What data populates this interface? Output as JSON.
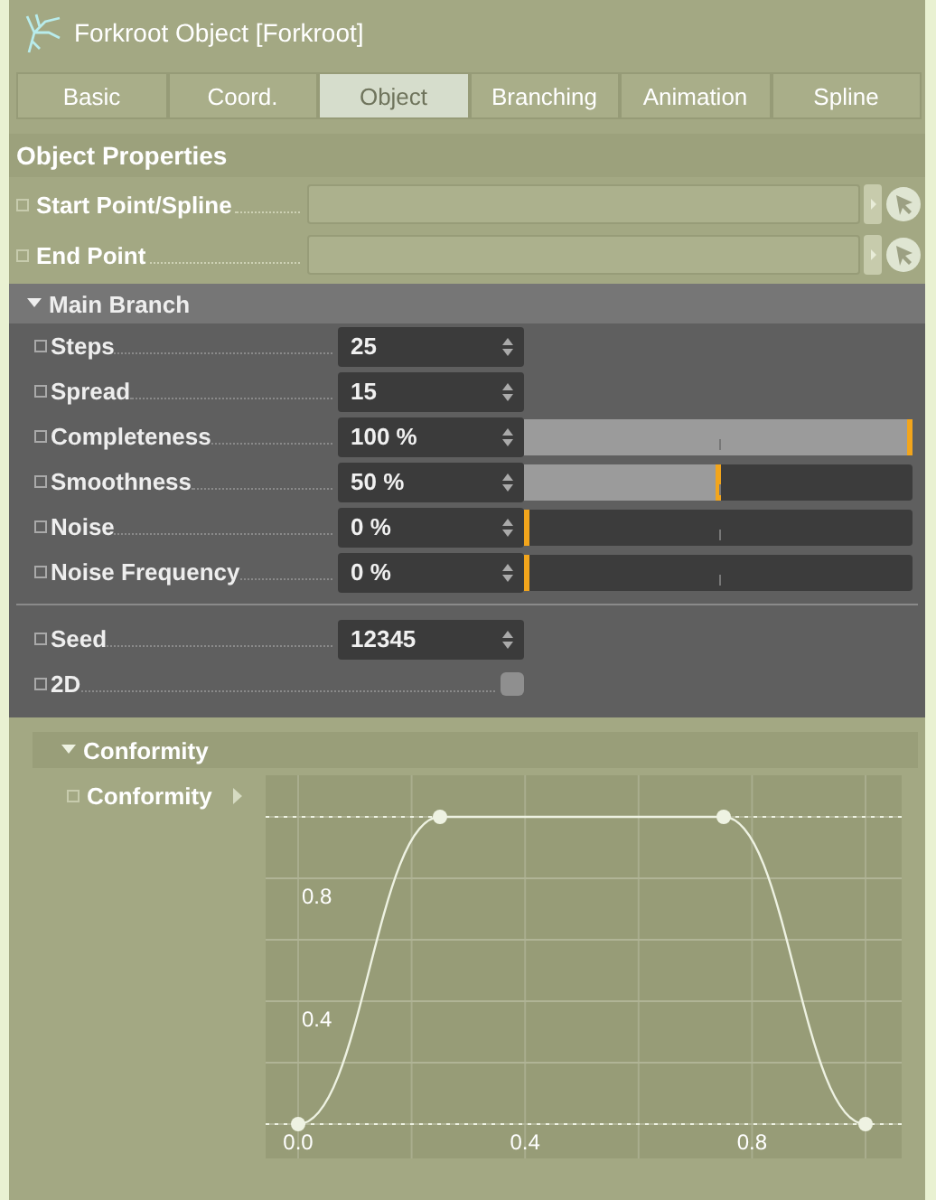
{
  "window": {
    "title": "Forkroot Object [Forkroot]"
  },
  "tabs": [
    {
      "label": "Basic",
      "selected": false
    },
    {
      "label": "Coord.",
      "selected": false
    },
    {
      "label": "Object",
      "selected": true
    },
    {
      "label": "Branching",
      "selected": false
    },
    {
      "label": "Animation",
      "selected": false
    },
    {
      "label": "Spline",
      "selected": false
    }
  ],
  "object_properties": {
    "title": "Object Properties",
    "links": [
      {
        "label": "Start Point/Spline"
      },
      {
        "label": "End Point"
      }
    ]
  },
  "main_branch": {
    "title": "Main Branch",
    "expanded": true,
    "parameters": [
      {
        "kind": "number",
        "label": "Steps",
        "value": "25"
      },
      {
        "kind": "number",
        "label": "Spread",
        "value": "15"
      },
      {
        "kind": "slider",
        "label": "Completeness",
        "value": "100 %",
        "level": 1
      },
      {
        "kind": "slider",
        "label": "Smoothness",
        "value": "50 %",
        "level": 0.5
      },
      {
        "kind": "slider",
        "label": "Noise",
        "value": "0 %",
        "level": 0
      },
      {
        "kind": "slider",
        "label": "Noise Frequency",
        "value": "0 %",
        "level": 0
      },
      {
        "kind": "divider"
      },
      {
        "kind": "number",
        "label": "Seed",
        "value": "12345"
      },
      {
        "kind": "checkbox",
        "label": "2D",
        "checked": false
      }
    ]
  },
  "conformity": {
    "title": "Conformity",
    "expanded": true,
    "parameter": {
      "label": "Conformity"
    },
    "chart_data": {
      "type": "line",
      "x": [
        0,
        0.25,
        0.75,
        1
      ],
      "grid": true,
      "series": [
        {
          "color": "#eef2e2",
          "marker": "circle",
          "values": [
            0,
            1,
            1,
            0
          ]
        }
      ],
      "xlim": [
        0,
        1
      ],
      "ylim": [
        0,
        1
      ],
      "xticks": [
        {
          "value": 0,
          "label": "0.0"
        },
        {
          "value": 0.4,
          "label": "0.4"
        },
        {
          "value": 0.8,
          "label": "0.8"
        }
      ],
      "yticks": [
        {
          "value": 0.4,
          "label": "0.4"
        },
        {
          "value": 0.8,
          "label": "0.8"
        }
      ]
    }
  }
}
